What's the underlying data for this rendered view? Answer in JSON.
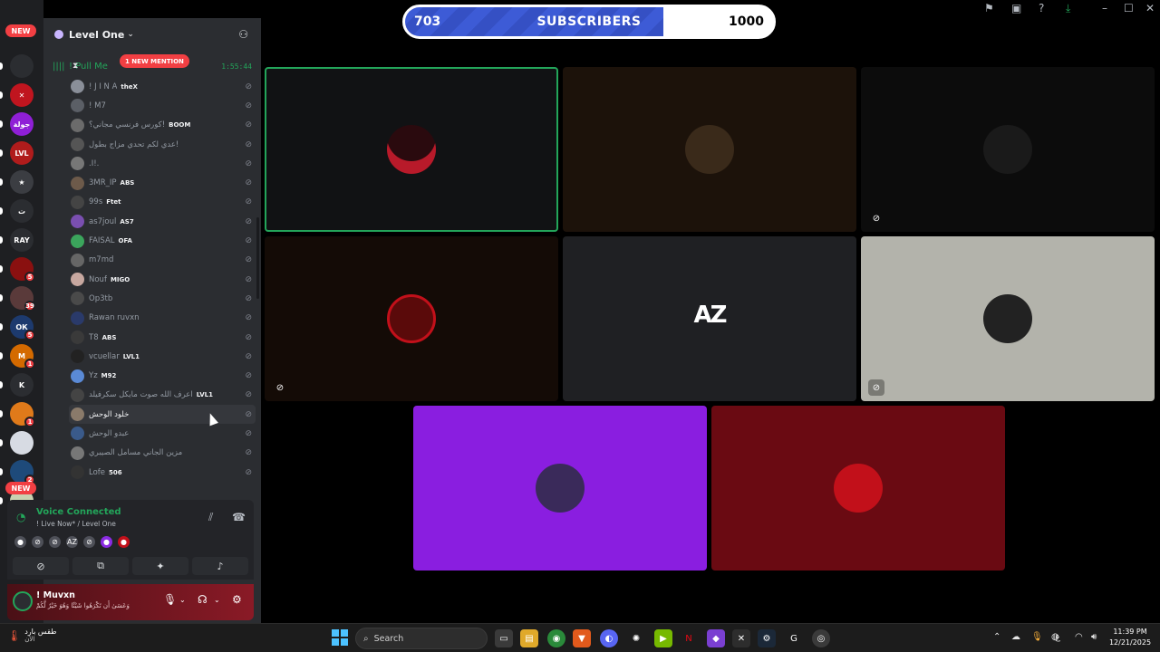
{
  "rail": {
    "new_pill_top": "NEW",
    "new_pill_bottom": "NEW",
    "servers": [
      {
        "label": "",
        "color": "#2b2d31"
      },
      {
        "label": "✕",
        "color": "#c0151f"
      },
      {
        "label": "جولة",
        "color": "#8f1fd6"
      },
      {
        "label": "LVL",
        "color": "#b01c1c"
      },
      {
        "label": "★",
        "color": "#3b3d42"
      },
      {
        "label": "ت",
        "color": "#2b2d31"
      },
      {
        "label": "RAY",
        "color": "#2b2d31"
      },
      {
        "label": "",
        "color": "#8a1010",
        "badge": "5"
      },
      {
        "label": "",
        "color": "#5a3a3a",
        "badge": "39"
      },
      {
        "label": "ОК",
        "color": "#1d3a6e",
        "badge": "5"
      },
      {
        "label": "M",
        "color": "#d46a00",
        "badge": "1"
      },
      {
        "label": "K",
        "color": "#2b2d31"
      },
      {
        "label": "",
        "color": "#e07a1a",
        "badge": "1"
      },
      {
        "label": "",
        "color": "#d7dbe3"
      },
      {
        "label": "",
        "color": "#1e4a7a",
        "badge": "2"
      },
      {
        "label": "",
        "color": "#c9d1b0"
      }
    ]
  },
  "sidebar": {
    "guild_name": "Level One",
    "voice_channel": "! Pull Me",
    "mention_pill": "1 NEW MENTION",
    "elapsed": "1:55:44",
    "members": [
      {
        "name": "! J I N A",
        "tag": "theX",
        "color": "#8a8f99"
      },
      {
        "name": "! M7",
        "tag": "",
        "color": "#5b5f66"
      },
      {
        "name": "كورس فرنسي مجاني؟!",
        "tag": "BOOM",
        "color": "#6b6b6b"
      },
      {
        "name": "عدي لكم تحدي مزاج بطول!",
        "tag": "",
        "color": "#555"
      },
      {
        "name": ".I!.",
        "tag": "",
        "color": "#777"
      },
      {
        "name": "3MR_IP",
        "tag": "ABS",
        "color": "#6d5a4a"
      },
      {
        "name": "99s",
        "tag": "Ftet",
        "color": "#444"
      },
      {
        "name": "as7joul",
        "tag": "AS7",
        "color": "#7a4fb0"
      },
      {
        "name": "FAISAL",
        "tag": "OFA",
        "color": "#3ba55c"
      },
      {
        "name": "m7md",
        "tag": "",
        "color": "#666"
      },
      {
        "name": "Nouf",
        "tag": "MIGO",
        "color": "#c7a8a0"
      },
      {
        "name": "Op3tb",
        "tag": "",
        "color": "#4a4a4a"
      },
      {
        "name": "Rawan ruvxn",
        "tag": "",
        "color": "#2a3a6a"
      },
      {
        "name": "T8",
        "tag": "ABS",
        "color": "#3a3a3a"
      },
      {
        "name": "vcuellar",
        "tag": "LVL1",
        "color": "#222"
      },
      {
        "name": "Yz",
        "tag": "M92",
        "color": "#5a8ad6"
      },
      {
        "name": "اعرف الله صوت مايكل سكرفيلد",
        "tag": "LVL1",
        "color": "#444"
      },
      {
        "name": "خلود الوحش",
        "tag": "",
        "color": "#8a7a6a",
        "hover": true
      },
      {
        "name": "عبدو الوحش",
        "tag": "",
        "color": "#3a5a8a"
      },
      {
        "name": "مزين الجاني مسامل الصيبري",
        "tag": "",
        "color": "#777"
      },
      {
        "name": "Lofe",
        "tag": "506",
        "color": "#333"
      }
    ]
  },
  "voice_panel": {
    "status": "Voice Connected",
    "channel": "! Live Now* / Level One",
    "participant_icons": [
      "●",
      "⊘",
      "⊘",
      "AZ",
      "⊘",
      "●",
      "●"
    ],
    "buttons": [
      "camera-off",
      "screen-share",
      "activities",
      "soundboard"
    ]
  },
  "user_panel": {
    "name": "! Muvxn",
    "status": "وَعَسَىٰ أَن تَكْرَهُوا شَيْئًا وَهُوَ خَيْرٌ لَّكُمْ"
  },
  "subscribers": {
    "current": "703",
    "label": "SUBSCRIBERS",
    "goal": "1000",
    "progress": 0.703
  },
  "tiles": [
    {
      "name": "tile-batman",
      "bg": "#111214",
      "speaking": true,
      "avatar": "#2a0a0e"
    },
    {
      "name": "tile-man-dark",
      "bg": "#1c120a",
      "speaking": false,
      "avatar": "#3a2a1a"
    },
    {
      "name": "tile-silhouette",
      "bg": "#0c0c0c",
      "speaking": false,
      "avatar": "#1a1a1a",
      "muted": true
    },
    {
      "name": "tile-red-ring",
      "bg": "#140b06",
      "speaking": false,
      "avatar": "#5a0a0a",
      "muted": true
    },
    {
      "name": "tile-az-logo",
      "bg": "#1f2023",
      "speaking": false,
      "logo": "AZ"
    },
    {
      "name": "tile-astronaut",
      "bg": "#b3b3ab",
      "speaking": false,
      "avatar": "#222",
      "muted": true
    },
    {
      "name": "tile-purple",
      "bg": "#8a1ee0",
      "speaking": false,
      "avatar": "#3a2a5a"
    },
    {
      "name": "tile-red",
      "bg": "#6a0a12",
      "speaking": false,
      "avatar": "#c2101a"
    }
  ],
  "taskbar": {
    "weather_temp": "طقس بارد",
    "weather_desc": "الآن",
    "search_label": "Search",
    "clock_time": "11:39 PM",
    "clock_date": "12/21/2025",
    "lang": "ع"
  }
}
